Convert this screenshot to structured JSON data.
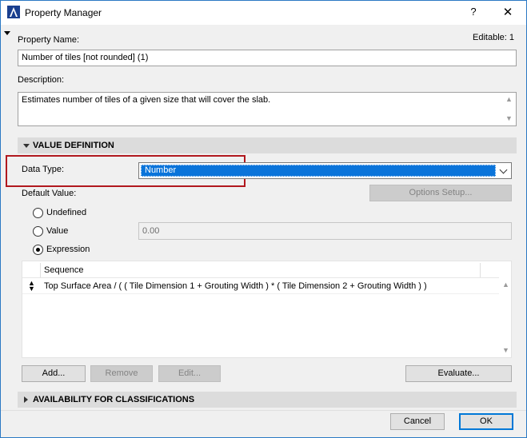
{
  "window": {
    "title": "Property Manager",
    "help_label": "?",
    "close_label": "✕"
  },
  "property": {
    "name_label": "Property Name:",
    "editable_text": "Editable: 1",
    "name_value": "Number of tiles [not rounded] (1)",
    "description_label": "Description:",
    "description_value": "Estimates number of tiles of a given size that will cover the slab."
  },
  "value_definition": {
    "section_label": "VALUE DEFINITION",
    "data_type_label": "Data Type:",
    "data_type_value": "Number",
    "default_value_label": "Default Value:",
    "options_setup_label": "Options Setup...",
    "radio_options": [
      {
        "label": "Undefined",
        "checked": false
      },
      {
        "label": "Value",
        "checked": false
      },
      {
        "label": "Expression",
        "checked": true
      }
    ],
    "value_field": "0.00",
    "table_header": "Sequence",
    "expression": "Top Surface Area / ( ( Tile Dimension 1 + Grouting Width ) * ( Tile Dimension 2 + Grouting Width ) )",
    "buttons": {
      "add": "Add...",
      "remove": "Remove",
      "edit": "Edit...",
      "evaluate": "Evaluate..."
    }
  },
  "availability": {
    "section_label": "AVAILABILITY FOR CLASSIFICATIONS"
  },
  "footer": {
    "cancel": "Cancel",
    "ok": "OK"
  },
  "colors": {
    "accent": "#0a74da",
    "highlight_frame": "#b1181e",
    "window_border": "#2b79c4"
  }
}
